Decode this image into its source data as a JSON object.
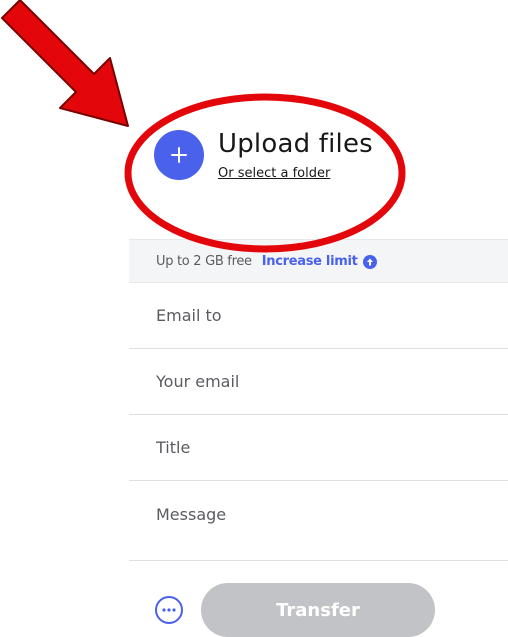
{
  "upload": {
    "title": "Upload files",
    "folder_link": "Or select a folder"
  },
  "limit": {
    "text": "Up to 2 GB free",
    "link": "Increase limit"
  },
  "form": {
    "email_to_placeholder": "Email to",
    "your_email_placeholder": "Your email",
    "title_placeholder": "Title",
    "message_placeholder": "Message"
  },
  "actions": {
    "transfer_label": "Transfer"
  },
  "colors": {
    "accent": "#4a62eb",
    "annotation": "#e3070b",
    "disabled_button": "#c2c3c6"
  },
  "icons": {
    "plus": "plus-icon",
    "up_arrow": "arrow-up-circle-icon",
    "more": "more-options-icon",
    "annotation_arrow": "annotation-arrow",
    "annotation_ellipse": "annotation-ellipse"
  }
}
